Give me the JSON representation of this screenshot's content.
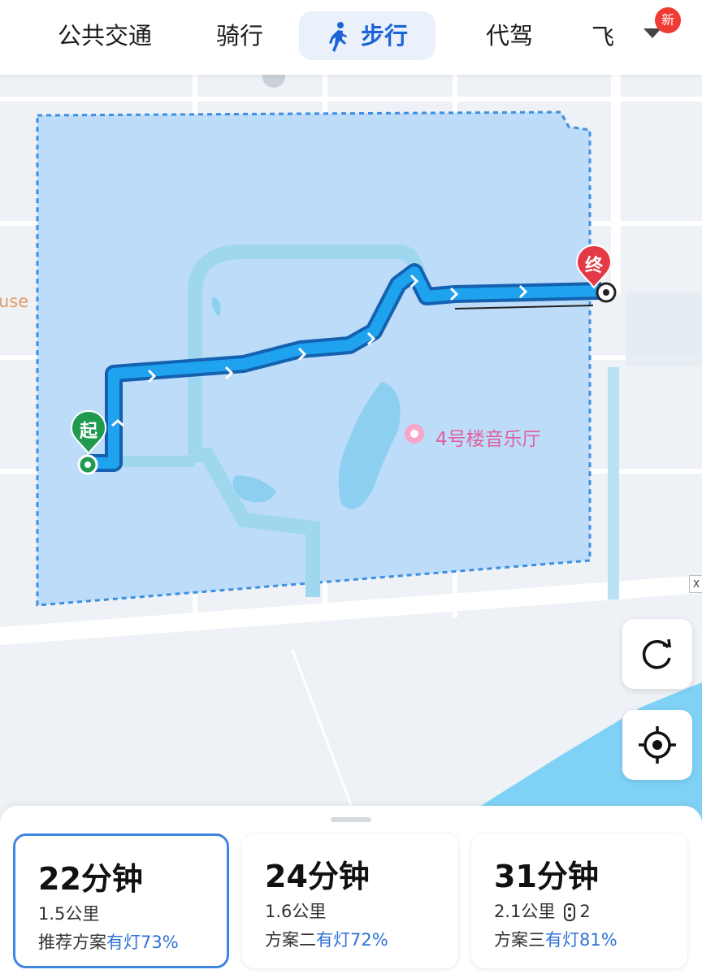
{
  "tabs": [
    {
      "label": "公共交通",
      "active": false
    },
    {
      "label": "骑行",
      "active": false
    },
    {
      "label": "步行",
      "active": true
    },
    {
      "label": "代驾",
      "active": false
    },
    {
      "label": "飞",
      "active": false
    }
  ],
  "badge": "新",
  "map": {
    "poi_label": "4号楼音乐厅",
    "edge_label": "use",
    "start_marker": "起",
    "end_marker": "终",
    "close_mark": "X",
    "route_color": "#1fa3ef",
    "area_color": "#bcdcfa"
  },
  "map_buttons": [
    {
      "name": "refresh",
      "icon": "refresh-icon"
    },
    {
      "name": "locate",
      "icon": "locate-icon"
    }
  ],
  "routes": [
    {
      "duration": "22分钟",
      "distance": "1.5公里",
      "plan": "推荐方案",
      "lights": "有灯73%",
      "traffic_lights": null,
      "selected": true
    },
    {
      "duration": "24分钟",
      "distance": "1.6公里",
      "plan": "方案二",
      "lights": "有灯72%",
      "traffic_lights": null,
      "selected": false
    },
    {
      "duration": "31分钟",
      "distance": "2.1公里",
      "plan": "方案三",
      "lights": "有灯81%",
      "traffic_lights": "2",
      "selected": false
    }
  ]
}
